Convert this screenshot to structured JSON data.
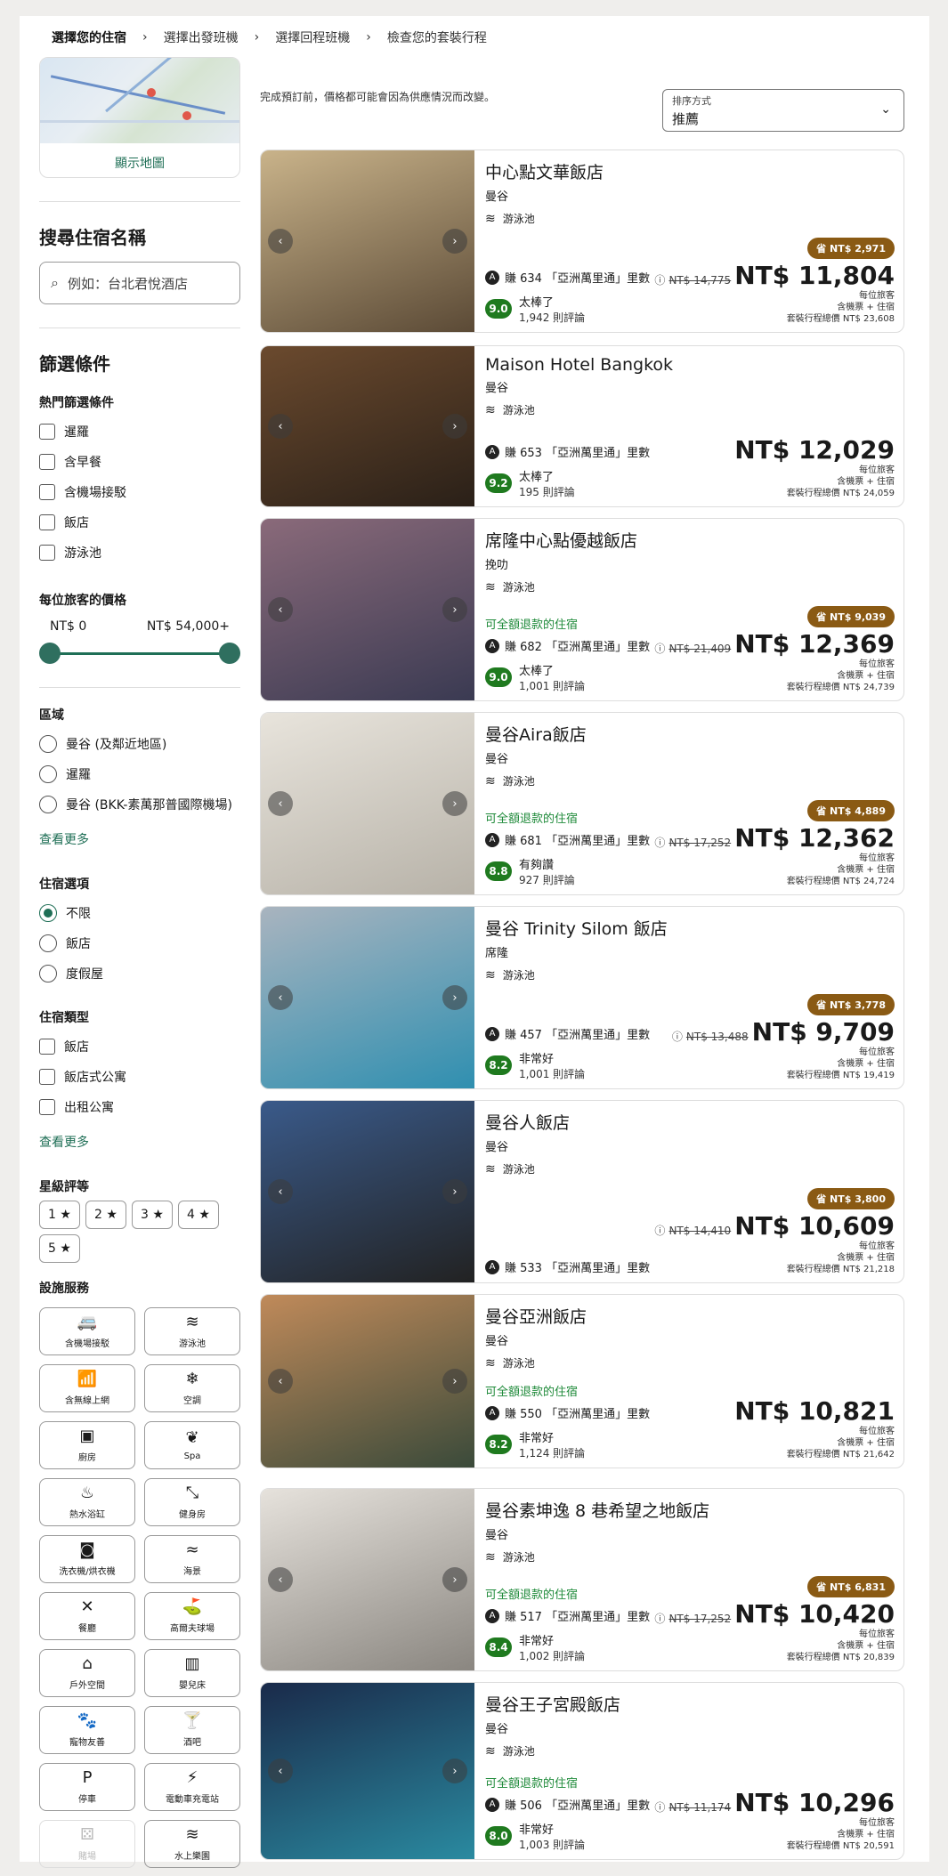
{
  "breadcrumb": [
    "選擇您的住宿",
    "選擇出發班機",
    "選擇回程班機",
    "檢查您的套裝行程"
  ],
  "sidebar": {
    "map_link": "顯示地圖",
    "search_title": "搜尋住宿名稱",
    "search_placeholder": "例如：台北君悅酒店",
    "filters_title": "篩選條件",
    "popular_title": "熱門篩選條件",
    "popular": [
      "暹羅",
      "含早餐",
      "含機場接駁",
      "飯店",
      "游泳池"
    ],
    "price_title": "每位旅客的價格",
    "price_min": "NT$ 0",
    "price_max": "NT$ 54,000+",
    "area_title": "區域",
    "areas": [
      "曼谷 (及鄰近地區)",
      "暹羅",
      "曼谷 (BKK-素萬那普國際機場)"
    ],
    "see_more": "查看更多",
    "lodging_title": "住宿選項",
    "lodging": [
      "不限",
      "飯店",
      "度假屋"
    ],
    "type_title": "住宿類型",
    "types": [
      "飯店",
      "飯店式公寓",
      "出租公寓"
    ],
    "star_title": "星級評等",
    "stars": [
      "1 ★",
      "2 ★",
      "3 ★",
      "4 ★",
      "5 ★"
    ],
    "amenity_title": "設施服務",
    "amenities": [
      {
        "label": "含機場接駁",
        "icon": "🚐"
      },
      {
        "label": "游泳池",
        "icon": "≋"
      },
      {
        "label": "含無線上網",
        "icon": "📶"
      },
      {
        "label": "空調",
        "icon": "❄"
      },
      {
        "label": "廚房",
        "icon": "▣"
      },
      {
        "label": "Spa",
        "icon": "❦"
      },
      {
        "label": "熱水浴缸",
        "icon": "♨"
      },
      {
        "label": "健身房",
        "icon": "⤡"
      },
      {
        "label": "洗衣機/烘衣機",
        "icon": "◙"
      },
      {
        "label": "海景",
        "icon": "≈"
      },
      {
        "label": "餐廳",
        "icon": "✕"
      },
      {
        "label": "高爾夫球場",
        "icon": "⛳"
      },
      {
        "label": "戶外空間",
        "icon": "⌂"
      },
      {
        "label": "嬰兒床",
        "icon": "▥"
      },
      {
        "label": "寵物友善",
        "icon": "🐾"
      },
      {
        "label": "酒吧",
        "icon": "🍸"
      },
      {
        "label": "停車",
        "icon": "P"
      },
      {
        "label": "電動車充電站",
        "icon": "⚡"
      },
      {
        "label": "賭場",
        "icon": "⚄"
      },
      {
        "label": "水上樂園",
        "icon": "≋"
      }
    ]
  },
  "main": {
    "note": "完成預訂前，價格都可能會因為供應情況而改變。",
    "sort_label": "排序方式",
    "sort_value": "推薦",
    "refund_text": "可全額退款的住宿",
    "per_person": "每位旅客",
    "incl": "含機票 + 住宿",
    "hotels": [
      {
        "name": "中心點文華飯店",
        "city": "曼谷",
        "pool": "游泳池",
        "earn": "賺 634 「亞洲萬里通」里數",
        "score": "9.0",
        "rating": "太棒了",
        "reviews": "1,942 則評論",
        "badge": "省 NT$ 2,971",
        "old": "NT$ 14,775",
        "price": "NT$ 11,804",
        "total": "套裝行程總價 NT$ 23,608",
        "refund": false,
        "colors": [
          "#c9b38a",
          "#5b4a36"
        ]
      },
      {
        "name": "Maison Hotel Bangkok",
        "city": "曼谷",
        "pool": "游泳池",
        "earn": "賺 653 「亞洲萬里通」里數",
        "score": "9.2",
        "rating": "太棒了",
        "reviews": "195 則評論",
        "badge": "",
        "old": "",
        "price": "NT$ 12,029",
        "total": "套裝行程總價 NT$ 24,059",
        "refund": false,
        "colors": [
          "#6b4a2e",
          "#2a2018"
        ]
      },
      {
        "name": "席隆中心點優越飯店",
        "city": "挽叻",
        "pool": "游泳池",
        "earn": "賺 682 「亞洲萬里通」里數",
        "score": "9.0",
        "rating": "太棒了",
        "reviews": "1,001 則評論",
        "badge": "省 NT$ 9,039",
        "old": "NT$ 21,409",
        "price": "NT$ 12,369",
        "total": "套裝行程總價 NT$ 24,739",
        "refund": true,
        "colors": [
          "#8a6a7a",
          "#3a3a52"
        ]
      },
      {
        "name": "曼谷Aira飯店",
        "city": "曼谷",
        "pool": "游泳池",
        "earn": "賺 681 「亞洲萬里通」里數",
        "score": "8.8",
        "rating": "有夠讚",
        "reviews": "927 則評論",
        "badge": "省 NT$ 4,889",
        "old": "NT$ 17,252",
        "price": "NT$ 12,362",
        "total": "套裝行程總價 NT$ 24,724",
        "refund": true,
        "colors": [
          "#e8e4dc",
          "#b7b2a8"
        ]
      },
      {
        "name": "曼谷 Trinity Silom 飯店",
        "city": "席隆",
        "pool": "游泳池",
        "earn": "賺 457 「亞洲萬里通」里數",
        "score": "8.2",
        "rating": "非常好",
        "reviews": "1,001 則評論",
        "badge": "省 NT$ 3,778",
        "old": "NT$ 13,488",
        "price": "NT$ 9,709",
        "total": "套裝行程總價 NT$ 19,419",
        "refund": false,
        "colors": [
          "#a9b4bf",
          "#2f8fb0"
        ]
      },
      {
        "name": "曼谷人飯店",
        "city": "曼谷",
        "pool": "游泳池",
        "earn": "賺 533 「亞洲萬里通」里數",
        "score": "",
        "rating": "",
        "reviews": "",
        "badge": "省 NT$ 3,800",
        "old": "NT$ 14,410",
        "price": "NT$ 10,609",
        "total": "套裝行程總價 NT$ 21,218",
        "refund": false,
        "colors": [
          "#3a5a8a",
          "#222222"
        ]
      },
      {
        "name": "曼谷亞洲飯店",
        "city": "曼谷",
        "pool": "游泳池",
        "earn": "賺 550 「亞洲萬里通」里數",
        "score": "8.2",
        "rating": "非常好",
        "reviews": "1,124 則評論",
        "badge": "",
        "old": "",
        "price": "NT$ 10,821",
        "total": "套裝行程總價 NT$ 21,642",
        "refund": true,
        "colors": [
          "#c08a5a",
          "#3a4a3a"
        ]
      },
      {
        "name": "曼谷素坤逸 8 巷希望之地飯店",
        "city": "曼谷",
        "pool": "游泳池",
        "earn": "賺 517 「亞洲萬里通」里數",
        "score": "8.4",
        "rating": "非常好",
        "reviews": "1,002 則評論",
        "badge": "省 NT$ 6,831",
        "old": "NT$ 17,252",
        "price": "NT$ 10,420",
        "total": "套裝行程總價 NT$ 20,839",
        "refund": true,
        "colors": [
          "#e6e2dc",
          "#8a8680"
        ]
      },
      {
        "name": "曼谷王子宮殿飯店",
        "city": "曼谷",
        "pool": "游泳池",
        "earn": "賺 506 「亞洲萬里通」里數",
        "score": "8.0",
        "rating": "非常好",
        "reviews": "1,003 則評論",
        "badge": "",
        "old": "NT$ 11,174",
        "price": "NT$ 10,296",
        "total": "套裝行程總價 NT$ 20,591",
        "refund": true,
        "colors": [
          "#1a2a4a",
          "#2a8aa0"
        ]
      }
    ]
  }
}
